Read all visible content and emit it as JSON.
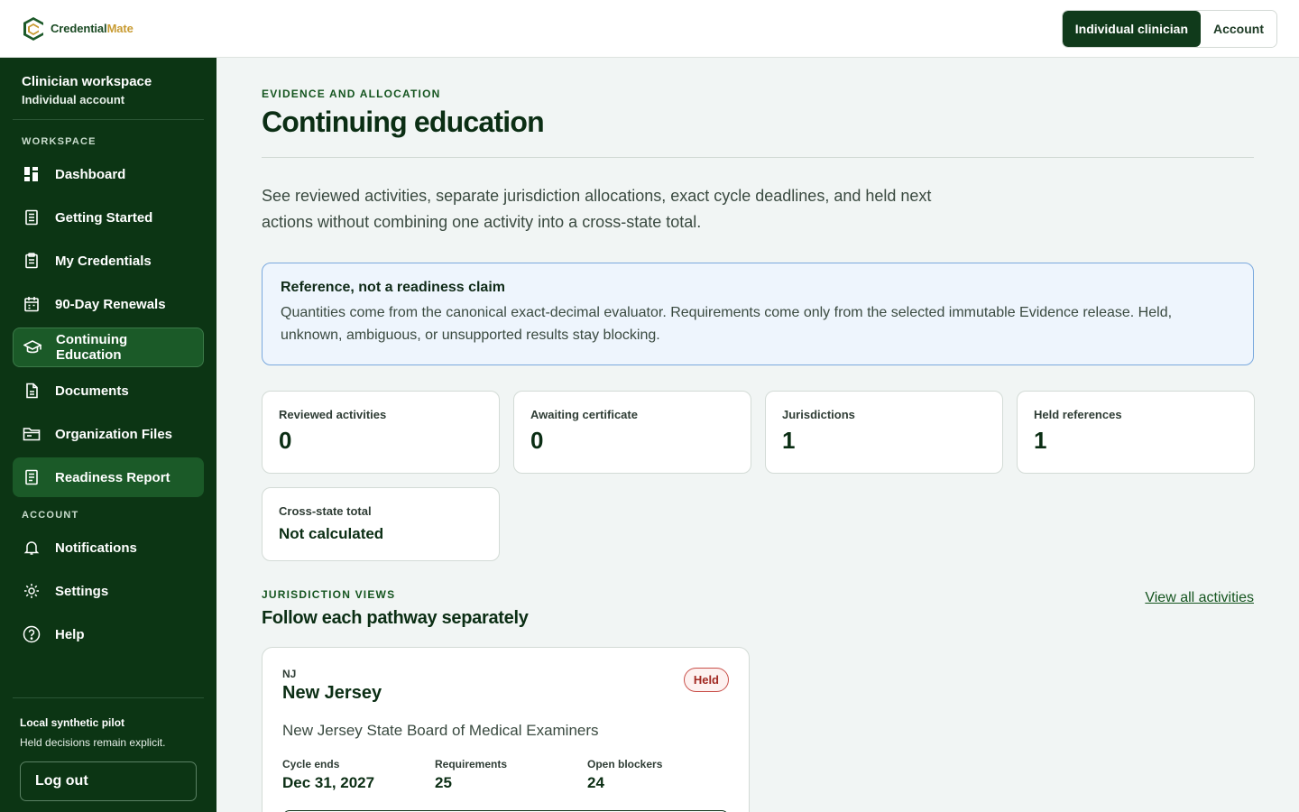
{
  "header": {
    "logo_text_main": "Credential",
    "logo_text_accent": "Mate",
    "mode_active": "Individual clinician",
    "mode_other": "Account"
  },
  "sidebar": {
    "workspace_title": "Clinician workspace",
    "workspace_sub": "Individual account",
    "section_workspace": "WORKSPACE",
    "section_account": "ACCOUNT",
    "items": [
      {
        "label": "Dashboard",
        "icon": "dashboard-icon"
      },
      {
        "label": "Getting Started",
        "icon": "checklist-icon"
      },
      {
        "label": "My Credentials",
        "icon": "clipboard-icon"
      },
      {
        "label": "90-Day Renewals",
        "icon": "calendar-icon"
      },
      {
        "label": "Continuing Education",
        "icon": "graduation-cap-icon",
        "active": true
      },
      {
        "label": "Documents",
        "icon": "document-icon"
      },
      {
        "label": "Organization Files",
        "icon": "folder-icon"
      },
      {
        "label": "Readiness Report",
        "icon": "report-icon"
      }
    ],
    "account_items": [
      {
        "label": "Notifications",
        "icon": "bell-icon"
      },
      {
        "label": "Settings",
        "icon": "gear-icon"
      },
      {
        "label": "Help",
        "icon": "help-icon"
      }
    ],
    "footer_title": "Local synthetic pilot",
    "footer_sub": "Held decisions remain explicit.",
    "logout_label": "Log out"
  },
  "main": {
    "eyebrow": "EVIDENCE AND ALLOCATION",
    "title": "Continuing education",
    "intro": "See reviewed activities, separate jurisdiction allocations, exact cycle deadlines, and held next actions without combining one activity into a cross-state total.",
    "notice_title": "Reference, not a readiness claim",
    "notice_body": "Quantities come from the canonical exact-decimal evaluator. Requirements come only from the selected immutable Evidence release. Held, unknown, ambiguous, or unsupported results stay blocking.",
    "stats": [
      {
        "label": "Reviewed activities",
        "value": "0"
      },
      {
        "label": "Awaiting certificate",
        "value": "0"
      },
      {
        "label": "Jurisdictions",
        "value": "1"
      },
      {
        "label": "Held references",
        "value": "1"
      }
    ],
    "cross_state": {
      "label": "Cross-state total",
      "value": "Not calculated"
    },
    "section_eyebrow": "JURISDICTION VIEWS",
    "section_title": "Follow each pathway separately",
    "view_all": "View all activities",
    "jurisdiction": {
      "code": "NJ",
      "name": "New Jersey",
      "badge": "Held",
      "board": "New Jersey State Board of Medical Examiners",
      "cycle_label": "Cycle ends",
      "cycle_value": "Dec 31, 2027",
      "req_label": "Requirements",
      "req_value": "25",
      "blockers_label": "Open blockers",
      "blockers_value": "24"
    }
  }
}
